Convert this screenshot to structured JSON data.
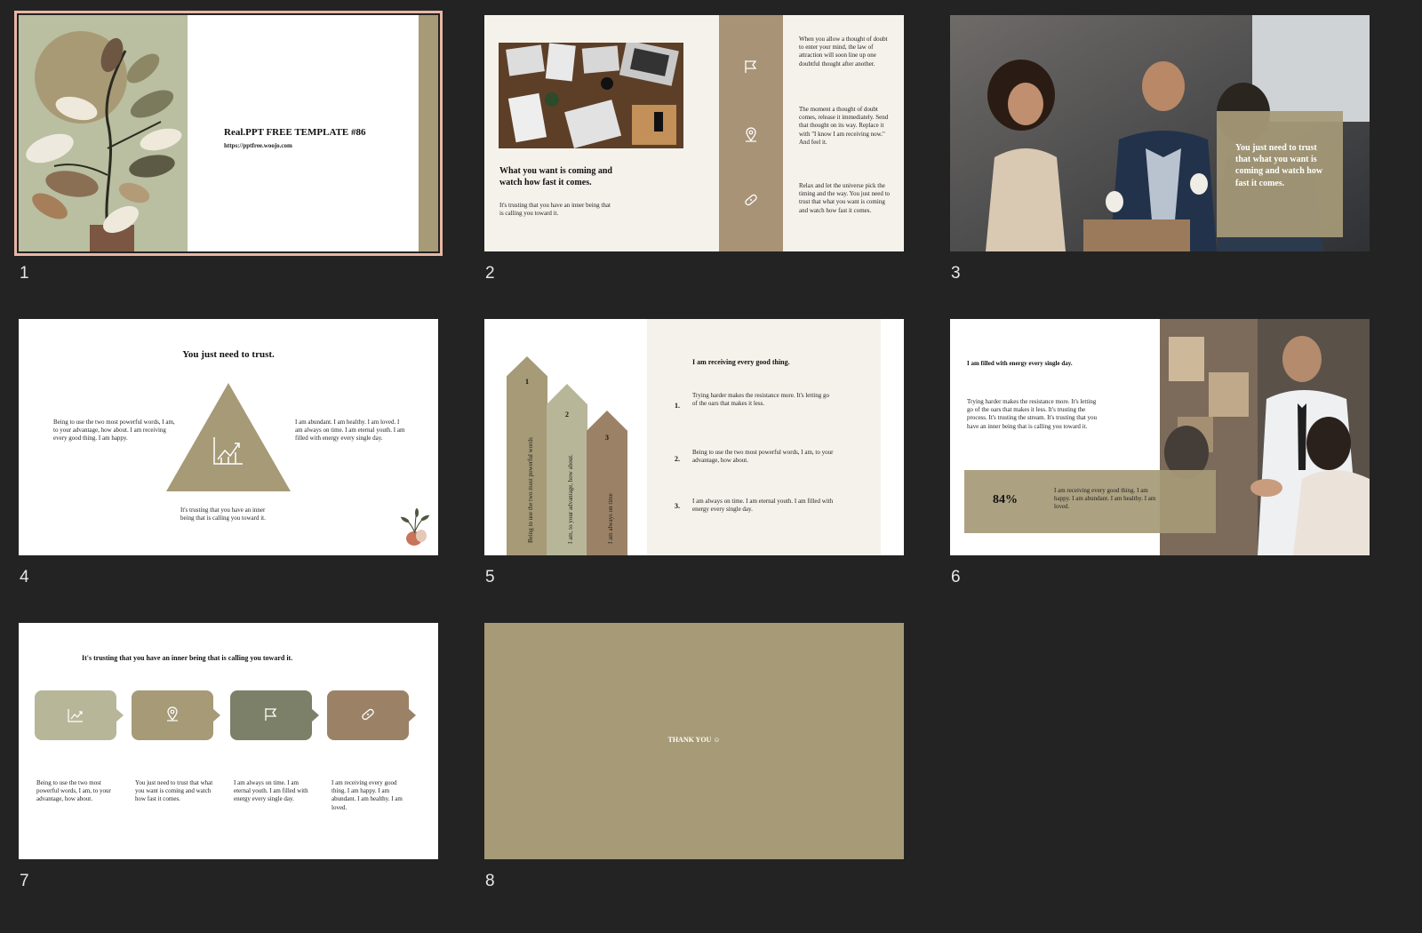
{
  "colors": {
    "background": "#232323",
    "tan": "#a69a77",
    "tan_dark": "#9b8567",
    "sage": "#b8b699",
    "olive": "#7d8068",
    "brown": "#a88d74",
    "cream": "#f5f2ec",
    "selection": "#e8b7a4"
  },
  "slides": [
    {
      "number": "1",
      "title": "Real.PPT FREE TEMPLATE #86",
      "url": "https://pptfree.woojo.com"
    },
    {
      "number": "2",
      "headline": "What you want is coming and watch how fast it comes.",
      "body": "It's trusting that you have an inner being that is calling you toward it.",
      "icons": [
        "flag-icon",
        "location-icon",
        "bandage-icon"
      ],
      "paragraphs": [
        "When you allow a thought of doubt to enter your mind, the law of attraction will soon line up one doubtful thought after another.",
        "The moment a thought of doubt comes, release it immediately. Send that thought on its way. Replace it with \"I know I am receiving now.\" And feel it.",
        "Relax and let the universe pick the timing and the way. You just need to trust that what you want is coming and watch how fast it comes."
      ]
    },
    {
      "number": "3",
      "overlay": "You just need to trust that what you want is coming and watch how fast it comes."
    },
    {
      "number": "4",
      "title": "You just need to trust.",
      "left": "Being to use the two most powerful words, I am, to your advantage, how about. I am receiving every good thing. I am happy.",
      "right": "I am abundant. I am healthy. I am loved. I am always on time. I am eternal youth. I am filled with energy every single day.",
      "bottom": "It's trusting that you have an inner being that is calling you toward it."
    },
    {
      "number": "5",
      "title": "I am receiving every good thing.",
      "bars": [
        {
          "n": "1",
          "label": "Being to use the two most powerful words"
        },
        {
          "n": "2",
          "label": "I am, to your advantage, how about."
        },
        {
          "n": "3",
          "label": "I am always on time"
        }
      ],
      "items": [
        {
          "n": "1.",
          "text": "Trying harder makes the resistance more. It's letting go of the oars that makes it less."
        },
        {
          "n": "2.",
          "text": "Being to use the two most powerful words, I am, to your advantage, how about."
        },
        {
          "n": "3.",
          "text": "I am always on time. I am eternal youth. I am filled with energy every single day."
        }
      ]
    },
    {
      "number": "6",
      "title": "I am filled with energy every single day.",
      "body": "Trying harder makes the resistance more. It's letting go of the oars that makes it less. It's trusting the process. It's trusting the stream. It's trusting that you have an inner being that is calling you toward it.",
      "stat": "84%",
      "stat_text": "I am receiving every good thing. I am happy. I am abundant. I am healthy. I am loved."
    },
    {
      "number": "7",
      "title": "It's trusting that you have an inner being that is calling you toward it.",
      "steps": [
        {
          "icon": "chart-icon",
          "text": "Being to use the two most powerful words, I am, to your advantage, how about."
        },
        {
          "icon": "location-icon",
          "text": "You just need to trust that what you want is coming and watch how fast it comes."
        },
        {
          "icon": "flag-icon",
          "text": "I am always on time. I am eternal youth. I am filled with energy every single day."
        },
        {
          "icon": "bandage-icon",
          "text": "I am receiving every good thing. I am happy. I am abundant. I am healthy. I am loved."
        }
      ]
    },
    {
      "number": "8",
      "text": "THANK YOU ☺"
    }
  ]
}
